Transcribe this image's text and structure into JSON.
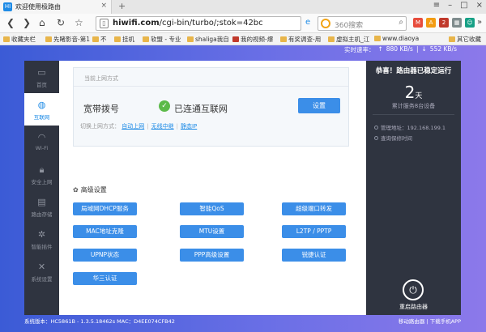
{
  "browser": {
    "tab_title": "欢迎使用极路由",
    "tab_favicon": "HI",
    "url_host": "hiwifi.com",
    "url_path": "/cgi-bin/turbo/;stok=42bc",
    "search_placeholder": "360搜索",
    "bookmarks": [
      "收藏夹栏",
      "先睹影音-第1",
      "不",
      "挂机",
      "软盟 - 专业",
      "shaliga我自",
      "我的视频-爆",
      "有奖调查-用",
      "虚拟主机_江",
      "www.diaoya",
      "其它收藏"
    ]
  },
  "speed": {
    "label": "实时速率：",
    "up": "880 KB/s",
    "down": "552 KB/s"
  },
  "sidebar": {
    "items": [
      {
        "label": "首页",
        "icon": "monitor-icon"
      },
      {
        "label": "互联网",
        "icon": "globe-icon"
      },
      {
        "label": "Wi-Fi",
        "icon": "wifi-icon"
      },
      {
        "label": "安全上网",
        "icon": "lock-icon"
      },
      {
        "label": "路由存储",
        "icon": "storage-icon"
      },
      {
        "label": "智能插件",
        "icon": "plugin-icon"
      },
      {
        "label": "系统设置",
        "icon": "tools-icon"
      }
    ]
  },
  "main": {
    "box_title": "当前上网方式",
    "conn_type": "宽带拨号",
    "conn_status": "已连通互联网",
    "set_button": "设置",
    "switch_label": "切换上网方式：",
    "switch_options": [
      "自动上网",
      "无线中继",
      "静态IP"
    ],
    "adv_title": "高级设置",
    "adv_buttons": [
      "局域网DHCP服务",
      "智能QoS",
      "超级端口转发",
      "MAC地址克隆",
      "MTU设置",
      "L2TP / PPTP",
      "UPNP状态",
      "PPP高级设置",
      "锐捷认证",
      "华三认证"
    ]
  },
  "right": {
    "title": "恭喜！路由器已稳定运行",
    "days_num": "2",
    "days_unit": "天",
    "days_label": "累计服务8台设备",
    "mgmt": "管理地址：192.168.199.1",
    "query": "查询保修时间",
    "reboot": "重启路由器"
  },
  "footer": {
    "left": "系统版本：HC5861B - 1.3.5.18462s     MAC：D4EE074CFB42",
    "right_1": "移动路由器",
    "right_2": "下载手机APP"
  },
  "colors": {
    "accent": "#3b8ee8",
    "sidebar": "#2f3440",
    "success": "#5cba4a"
  }
}
